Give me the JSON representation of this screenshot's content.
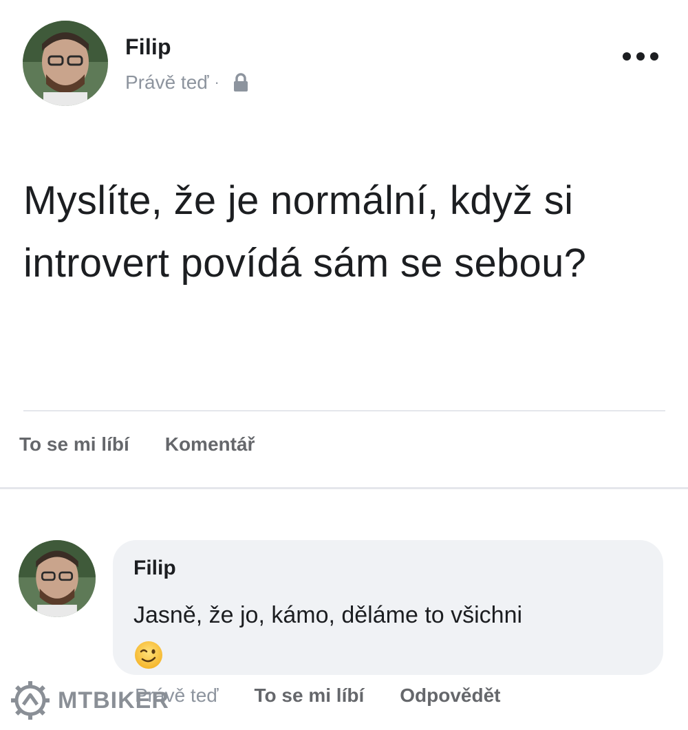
{
  "post": {
    "author": "Filip",
    "time": "Právě teď",
    "separator": "·",
    "privacy_icon": "lock-icon",
    "more_icon": "ellipsis-icon",
    "text": "Myslíte, že je normální, když si introvert povídá sám se sebou?"
  },
  "actions": {
    "like_label": "To se mi líbí",
    "comment_label": "Komentář"
  },
  "comment": {
    "author": "Filip",
    "text": "Jasně, že jo, kámo, děláme to všichni",
    "emoji": "winking-face-emoji",
    "time": "Právě teď",
    "like_label": "To se mi líbí",
    "reply_label": "Odpovědět"
  },
  "watermark": {
    "text": "MTBIKER",
    "logo_icon": "mtbiker-logo-icon"
  },
  "colors": {
    "name_text": "#1c1e21",
    "meta_text": "#8d949e",
    "action_text": "#65676b",
    "bubble_bg": "#f0f2f5",
    "divider": "#e4e6eb"
  }
}
